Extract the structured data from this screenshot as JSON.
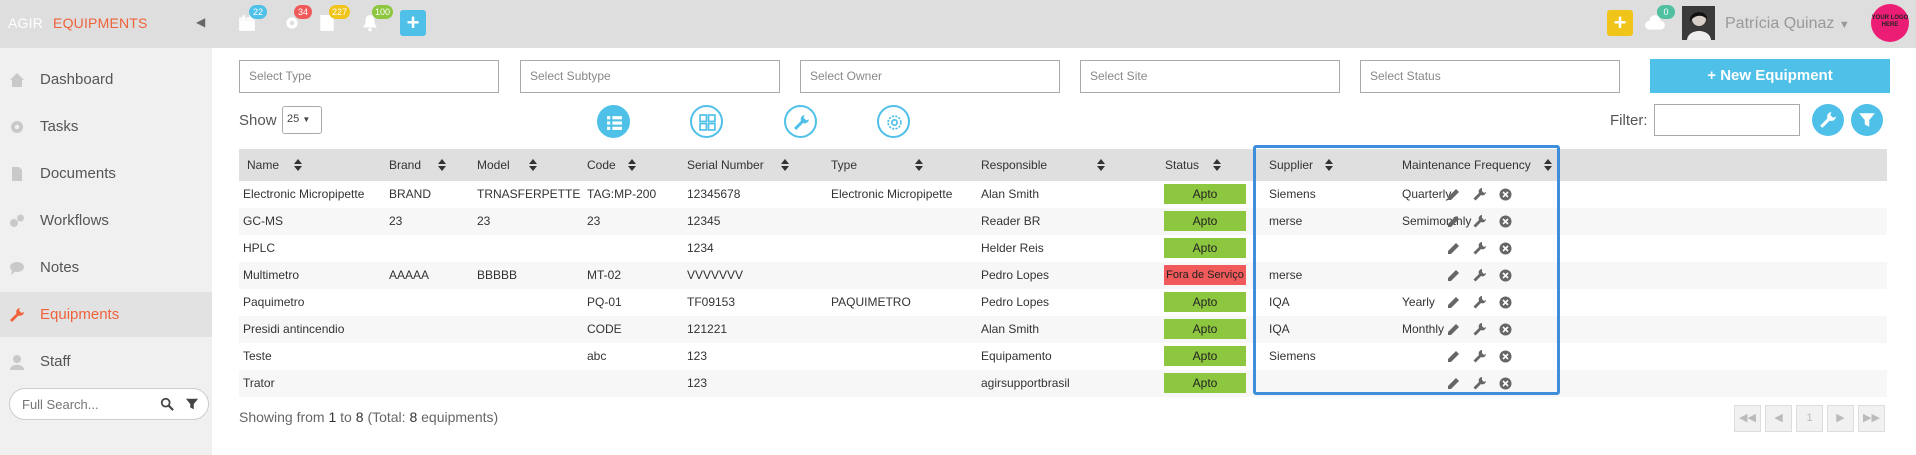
{
  "app": {
    "brand_prefix": "AGIR",
    "brand_module": "EQUIPMENTS",
    "user_name": "Patrícia Quinaz",
    "logo_text": "YOUR LOGO HERE",
    "colors": {
      "accent_orange": "#f0623a",
      "accent_blue": "#4fc0e8",
      "status_ok": "#8dc63f",
      "status_out": "#f05a5a",
      "highlight": "#3e8edb"
    }
  },
  "topbar": {
    "badges": [
      {
        "icon": "calendar-icon",
        "count": "22",
        "color": "#4fc0e8"
      },
      {
        "icon": "gear-icon",
        "count": "34",
        "color": "#f05a5a"
      },
      {
        "icon": "document-icon",
        "count": "227",
        "color": "#f0c419"
      },
      {
        "icon": "bell-icon",
        "count": "100",
        "color": "#8dc63f"
      }
    ],
    "cloud_badge": "0"
  },
  "sidebar": {
    "items": [
      {
        "label": "Dashboard",
        "icon": "home-icon"
      },
      {
        "label": "Tasks",
        "icon": "gear-icon"
      },
      {
        "label": "Documents",
        "icon": "document-icon"
      },
      {
        "label": "Workflows",
        "icon": "gears-icon"
      },
      {
        "label": "Notes",
        "icon": "chat-icon"
      },
      {
        "label": "Equipments",
        "icon": "wrench-icon"
      },
      {
        "label": "Staff",
        "icon": "user-icon"
      }
    ],
    "search_placeholder": "Full Search..."
  },
  "filters": {
    "type": "Select Type",
    "subtype": "Select Subtype",
    "owner": "Select Owner",
    "site": "Select Site",
    "status": "Select Status",
    "new_button": "New Equipment",
    "show_label": "Show",
    "show_value": "25",
    "filter_label": "Filter:"
  },
  "table": {
    "columns": [
      "Name",
      "Brand",
      "Model",
      "Code",
      "Serial Number",
      "Type",
      "Responsible",
      "Status",
      "Supplier",
      "Maintenance Frequency"
    ],
    "rows": [
      {
        "name": "Electronic Micropipette",
        "brand": "BRAND",
        "model": "TRNASFERPETTE",
        "code": "TAG:MP-200",
        "serial": "12345678",
        "type": "Electronic Micropipette",
        "responsible": "Alan Smith",
        "status": "Apto",
        "supplier": "Siemens",
        "frequency": "Quarterly"
      },
      {
        "name": "GC-MS",
        "brand": "23",
        "model": "23",
        "code": "23",
        "serial": "12345",
        "type": "",
        "responsible": "Reader BR",
        "status": "Apto",
        "supplier": "merse",
        "frequency": "Semimonthly"
      },
      {
        "name": "HPLC",
        "brand": "",
        "model": "",
        "code": "",
        "serial": "1234",
        "type": "",
        "responsible": "Helder Reis",
        "status": "Apto",
        "supplier": "",
        "frequency": ""
      },
      {
        "name": "Multimetro",
        "brand": "AAAAA",
        "model": "BBBBB",
        "code": "MT-02",
        "serial": "VVVVVVV",
        "type": "",
        "responsible": "Pedro Lopes",
        "status": "Fora de Serviço",
        "supplier": "merse",
        "frequency": ""
      },
      {
        "name": "Paquimetro",
        "brand": "",
        "model": "",
        "code": "PQ-01",
        "serial": "TF09153",
        "type": "PAQUIMETRO",
        "responsible": "Pedro Lopes",
        "status": "Apto",
        "supplier": "IQA",
        "frequency": "Yearly"
      },
      {
        "name": "Presidi antincendio",
        "brand": "",
        "model": "",
        "code": "CODE",
        "serial": "121221",
        "type": "",
        "responsible": "Alan Smith",
        "status": "Apto",
        "supplier": "IQA",
        "frequency": "Monthly"
      },
      {
        "name": "Teste",
        "brand": "",
        "model": "",
        "code": "abc",
        "serial": "123",
        "type": "",
        "responsible": "Equipamento",
        "status": "Apto",
        "supplier": "Siemens",
        "frequency": ""
      },
      {
        "name": "Trator",
        "brand": "",
        "model": "",
        "code": "",
        "serial": "123",
        "type": "",
        "responsible": "agirsupportbrasil",
        "status": "Apto",
        "supplier": "",
        "frequency": ""
      }
    ]
  },
  "footer": {
    "prefix": "Showing from",
    "from": "1",
    "to_word": "to",
    "to": "8",
    "total_text": "(Total:",
    "total": "8",
    "suffix": "equipments)",
    "page": "1"
  }
}
